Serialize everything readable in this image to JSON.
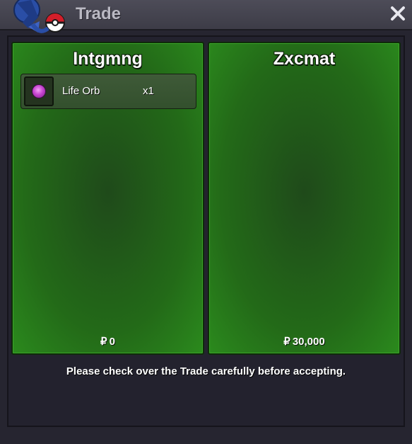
{
  "window": {
    "title": "Trade"
  },
  "left_side": {
    "name": "Intgmng",
    "items": [
      {
        "name": "Life Orb",
        "quantity": "x1",
        "icon": "life-orb-icon"
      }
    ],
    "currency_symbol": "₽",
    "money": "0"
  },
  "right_side": {
    "name": "Zxcmat",
    "items": [],
    "currency_symbol": "₽",
    "money": "30,000"
  },
  "notice": "Please check over the Trade carefully before accepting.",
  "colors": {
    "panel_green": "#236a18",
    "titlebar": "#45444f",
    "background": "#262530"
  }
}
